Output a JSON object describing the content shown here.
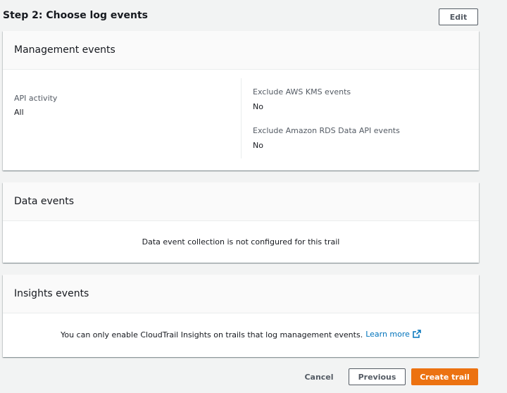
{
  "step": {
    "title": "Step 2: Choose log events",
    "edit_label": "Edit"
  },
  "management": {
    "title": "Management events",
    "api_activity_label": "API activity",
    "api_activity_value": "All",
    "kms_label": "Exclude AWS KMS events",
    "kms_value": "No",
    "rds_label": "Exclude Amazon RDS Data API events",
    "rds_value": "No"
  },
  "data_events": {
    "title": "Data events",
    "message": "Data event collection is not configured for this trail"
  },
  "insights": {
    "title": "Insights events",
    "message": "You can only enable CloudTrail Insights on trails that log management events.",
    "link_label": "Learn more",
    "link_icon": "external-link-icon"
  },
  "footer": {
    "cancel_label": "Cancel",
    "previous_label": "Previous",
    "create_label": "Create trail"
  },
  "colors": {
    "primary": "#ec7211",
    "link": "#0073bb",
    "background": "#f2f3f3"
  }
}
